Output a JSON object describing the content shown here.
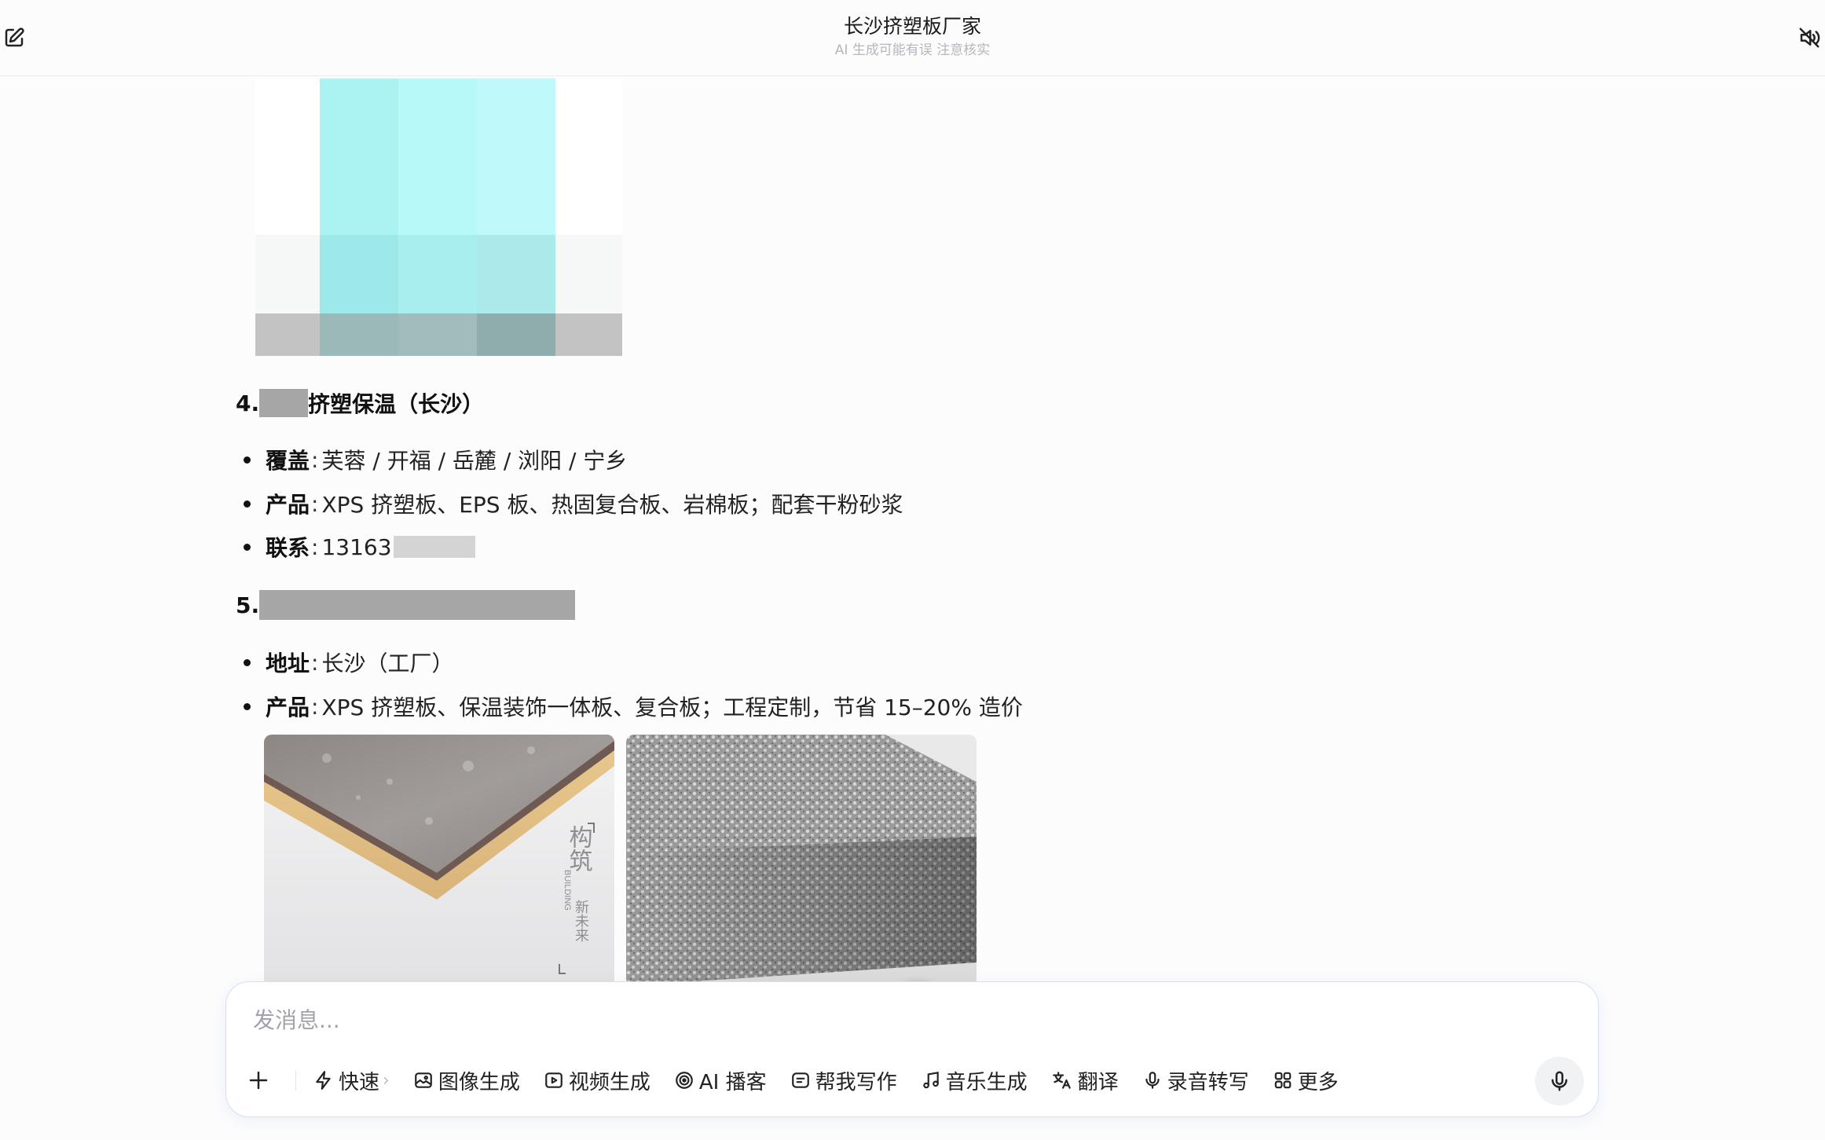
{
  "header": {
    "title": "长沙挤塑板厂家",
    "subtitle": "AI 生成可能有误 注意核实",
    "edit_icon": "edit-icon",
    "mute_icon": "speaker-mute-icon"
  },
  "sections": [
    {
      "heading_number": "4.",
      "heading_suffix": "挤塑保温（长沙）",
      "bullets": [
        {
          "key": "覆盖",
          "value": "芙蓉 / 开福 / 岳麓 / 浏阳 / 宁乡"
        },
        {
          "key": "产品",
          "value": "XPS 挤塑板、EPS 板、热固复合板、岩棉板；配套干粉砂浆"
        },
        {
          "key": "联系",
          "value": "13163"
        }
      ]
    },
    {
      "heading_number": "5.",
      "bullets": [
        {
          "key": "地址",
          "value": "长沙（工厂）"
        },
        {
          "key": "产品",
          "value": "XPS 挤塑板、保温装饰一体板、复合板；工程定制，节省 15–20% 造价"
        }
      ]
    }
  ],
  "images": {
    "image1_watermark_cn1": "构筑",
    "image1_watermark_en": "BUILDING",
    "image1_watermark_cn2": "新未来"
  },
  "composer": {
    "placeholder": "发消息...",
    "tools": [
      {
        "label": "快速",
        "icon": "lightning-icon"
      },
      {
        "label": "图像生成",
        "icon": "image-icon"
      },
      {
        "label": "视频生成",
        "icon": "video-icon"
      },
      {
        "label": "AI 播客",
        "icon": "podcast-icon"
      },
      {
        "label": "帮我写作",
        "icon": "write-icon"
      },
      {
        "label": "音乐生成",
        "icon": "music-icon"
      },
      {
        "label": "翻译",
        "icon": "translate-icon"
      },
      {
        "label": "录音转写",
        "icon": "mic-small-icon"
      },
      {
        "label": "更多",
        "icon": "grid-icon"
      }
    ]
  },
  "colors": {
    "accent_border": "#d3def7",
    "text_primary": "#111111",
    "redaction": "#a6a6a6"
  }
}
